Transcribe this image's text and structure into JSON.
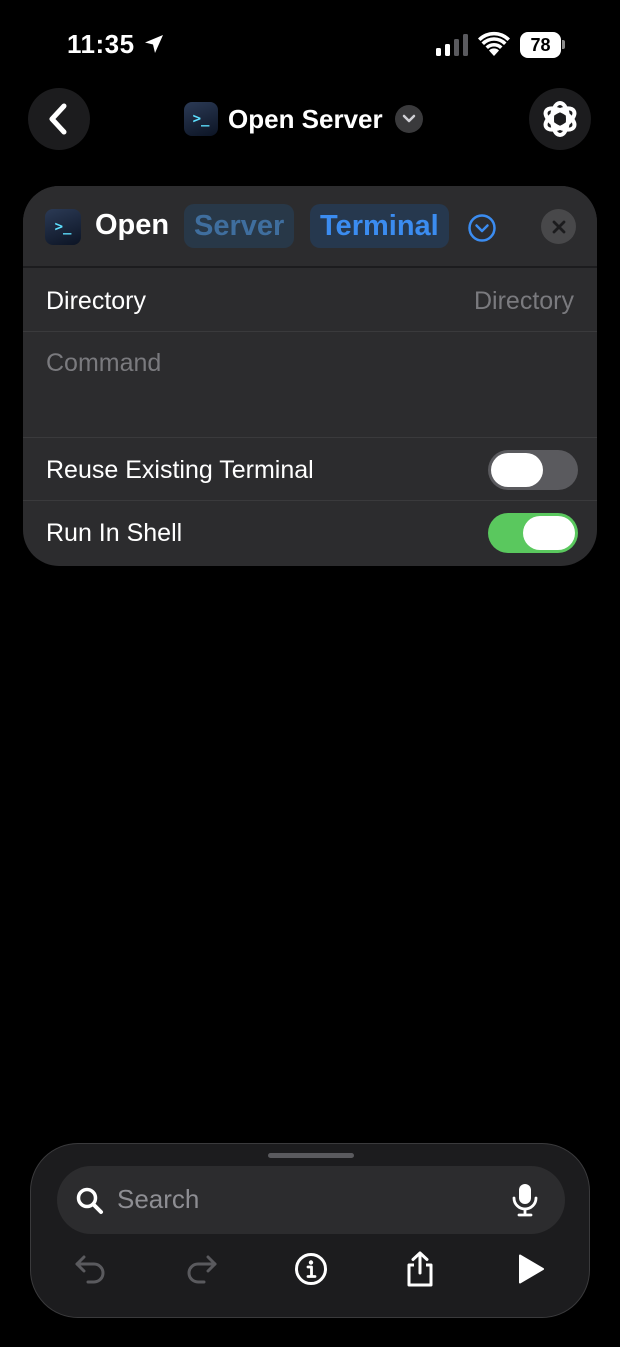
{
  "status_bar": {
    "time": "11:35",
    "battery": "78",
    "icons": [
      "location-arrow-icon",
      "cellular-signal-icon",
      "wifi-icon",
      "battery-icon"
    ]
  },
  "nav": {
    "title": "Open Server",
    "back_icon": "chevron-left-icon",
    "title_menu_icon": "chevron-down-icon",
    "settings_icon": "shortcut-settings-icon"
  },
  "action": {
    "app_icon_glyph": ">_",
    "verb": "Open",
    "parameter_server": "Server",
    "parameter_terminal": "Terminal",
    "expand_icon": "chevron-down-circle-icon",
    "close_icon": "close-icon",
    "directory_label": "Directory",
    "directory_placeholder": "Directory",
    "command_placeholder": "Command",
    "reuse_label": "Reuse Existing Terminal",
    "reuse_on": false,
    "shell_label": "Run In Shell",
    "shell_on": true
  },
  "colors": {
    "accent": "#3b8cf0",
    "toggle_on": "#5ac85e",
    "card_bg": "#2c2c2e"
  },
  "bottom": {
    "search_placeholder": "Search",
    "icons": [
      "search-icon",
      "microphone-icon",
      "undo-icon",
      "redo-icon",
      "info-icon",
      "share-icon",
      "play-icon"
    ]
  }
}
